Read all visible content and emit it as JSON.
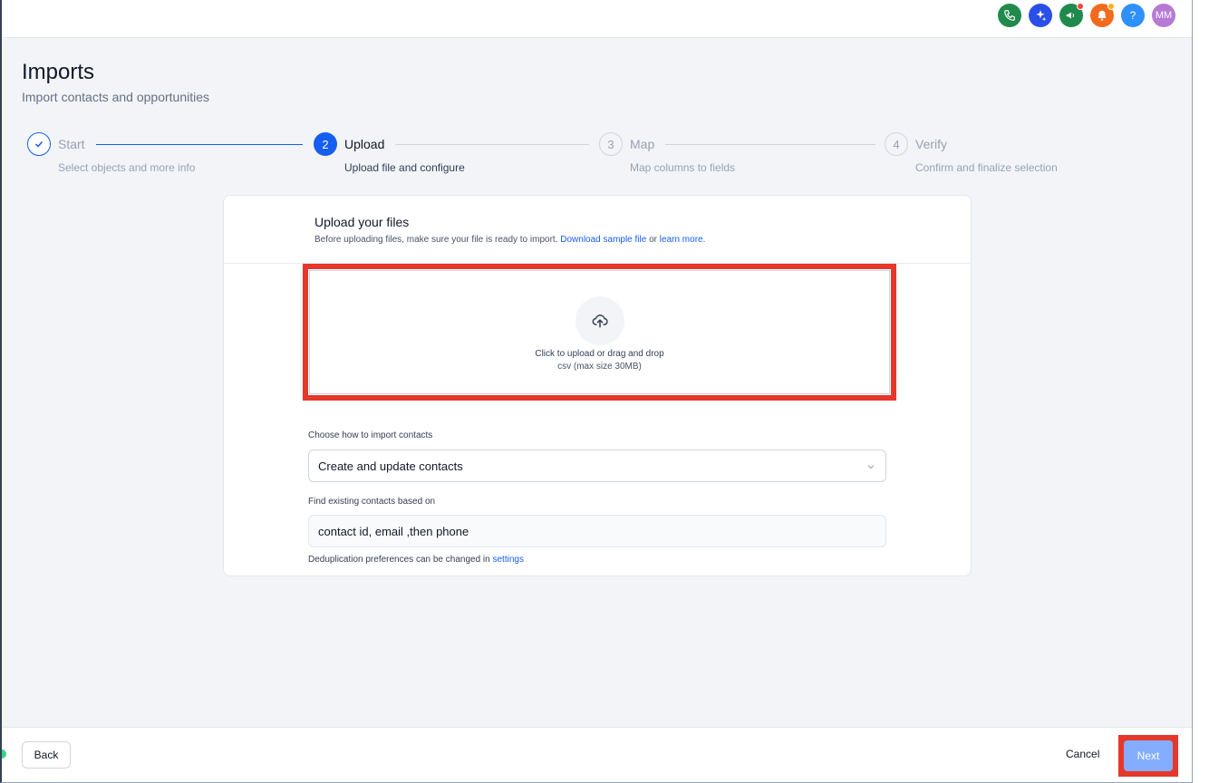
{
  "page": {
    "title": "Imports",
    "subtitle": "Import contacts and opportunities"
  },
  "topbar": {
    "avatar_initials": "MM",
    "help_glyph": "?",
    "icons": [
      "phone-icon",
      "sparkle-icon",
      "megaphone-icon",
      "bell-icon",
      "help-icon",
      "avatar"
    ],
    "colors": {
      "phone": "#1f8a4c",
      "sparkle": "#2a4ee8",
      "megaphone": "#1f8a4c",
      "bell": "#f26b1d",
      "help": "#2e90fa",
      "avatar": "#b67ad5"
    }
  },
  "steps": [
    {
      "number": "✓",
      "name": "Start",
      "description": "Select objects and more info",
      "state": "done"
    },
    {
      "number": "2",
      "name": "Upload",
      "description": "Upload file and configure",
      "state": "active"
    },
    {
      "number": "3",
      "name": "Map",
      "description": "Map columns to fields",
      "state": "future"
    },
    {
      "number": "4",
      "name": "Verify",
      "description": "Confirm and finalize selection",
      "state": "future"
    }
  ],
  "upload": {
    "title": "Upload your files",
    "subtitle_prefix": "Before uploading files, make sure your file is ready to import.",
    "download_link": "Download sample file",
    "or_text": "or",
    "learn_link": "learn more.",
    "dropzone_text": "Click to upload or drag and drop",
    "dropzone_sub": "csv (max size 30MB)"
  },
  "import_mode": {
    "label": "Choose how to import contacts",
    "value": "Create and update contacts"
  },
  "dedupe": {
    "label": "Find existing contacts based on",
    "value": "contact id, email ,then phone",
    "helper_text": "Deduplication preferences can be changed in",
    "helper_link": "settings"
  },
  "footer": {
    "back_label": "Back",
    "cancel_label": "Cancel",
    "next_label": "Next"
  },
  "colors": {
    "primary": "#155eef",
    "highlight": "#e5382b",
    "next_disabled": "#84adff"
  }
}
